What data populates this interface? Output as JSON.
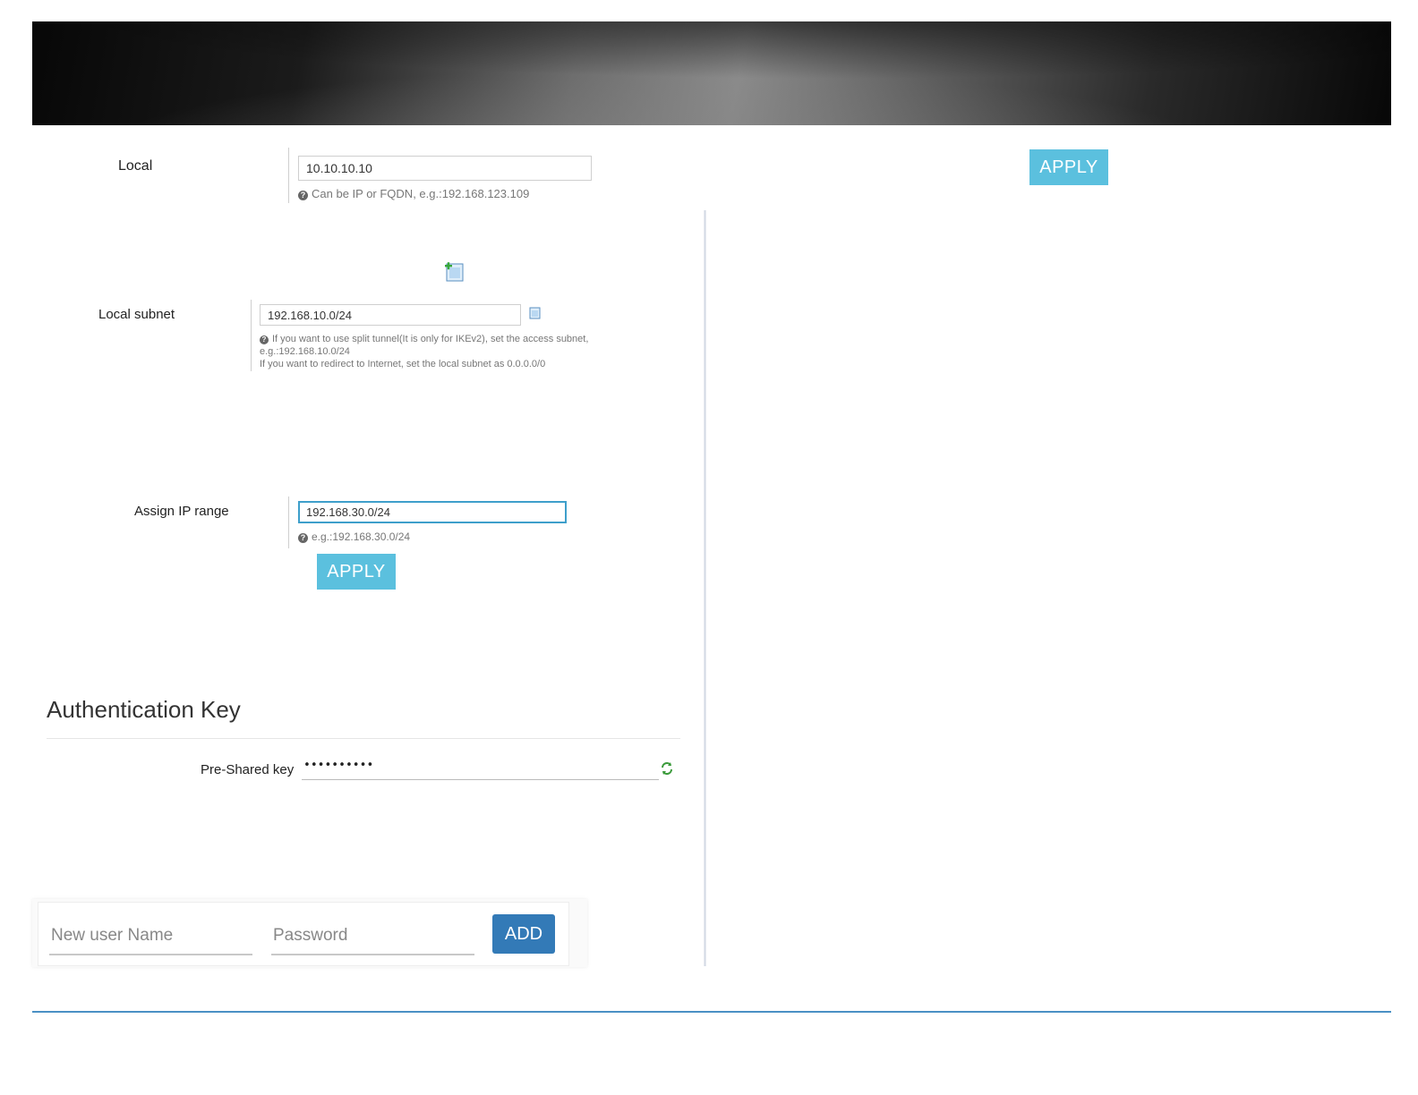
{
  "local": {
    "label": "Local",
    "value": "10.10.10.10",
    "hint": "Can be IP or FQDN, e.g.:192.168.123.109"
  },
  "top_apply_label": "APPLY",
  "local_subnet": {
    "label": "Local subnet",
    "value": "192.168.10.0/24",
    "hint_line1": "If you want to use split tunnel(It is only for IKEv2), set the access subnet,",
    "hint_line2": "e.g.:192.168.10.0/24",
    "hint_line3": "If you want to redirect to Internet, set the local subnet as 0.0.0.0/0"
  },
  "assign_ip": {
    "label": "Assign IP range",
    "value": "192.168.30.0/24",
    "hint": "e.g.:192.168.30.0/24",
    "apply_label": "APPLY"
  },
  "auth": {
    "title": "Authentication Key",
    "psk_label": "Pre-Shared key",
    "psk_value": "••••••••••"
  },
  "new_user": {
    "username_placeholder": "New user Name",
    "password_placeholder": "Password",
    "add_label": "ADD"
  },
  "icons": {
    "add_document": "add-document-icon",
    "document": "document-icon",
    "refresh": "refresh-icon",
    "help": "help-icon"
  },
  "colors": {
    "apply_button": "#5bc0de",
    "add_button": "#337ab7",
    "focus_border": "#3e9fcb",
    "footer_rule": "#4a90c4"
  }
}
